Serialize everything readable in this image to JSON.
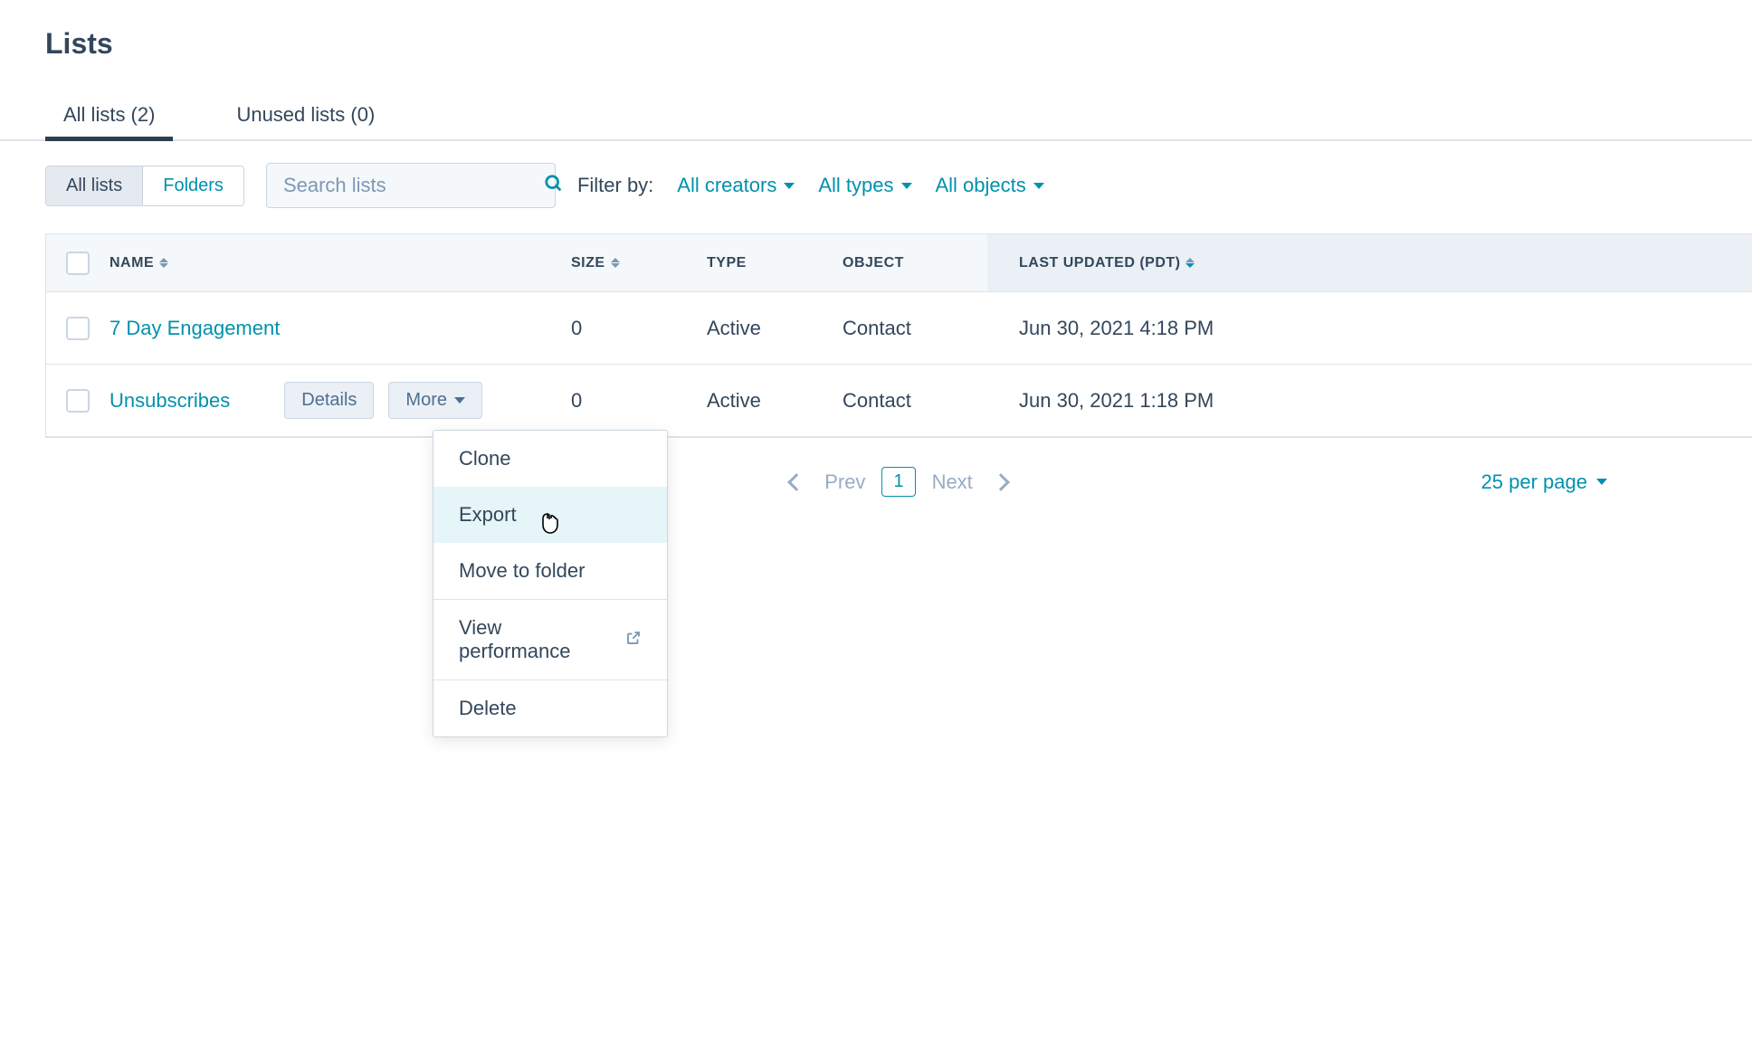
{
  "page": {
    "title": "Lists"
  },
  "tabs": [
    {
      "label": "All lists (2)",
      "active": true
    },
    {
      "label": "Unused lists (0)",
      "active": false
    }
  ],
  "segmented": {
    "all_lists": "All lists",
    "folders": "Folders"
  },
  "search": {
    "placeholder": "Search lists"
  },
  "filters": {
    "label": "Filter by:",
    "creators": "All creators",
    "types": "All types",
    "objects": "All objects"
  },
  "columns": {
    "name": "NAME",
    "size": "SIZE",
    "type": "TYPE",
    "object": "OBJECT",
    "last_updated": "LAST UPDATED (PDT)"
  },
  "rows": [
    {
      "name": "7 Day Engagement",
      "size": "0",
      "type": "Active",
      "object": "Contact",
      "updated": "Jun 30, 2021 4:18 PM"
    },
    {
      "name": "Unsubscribes",
      "size": "0",
      "type": "Active",
      "object": "Contact",
      "updated": "Jun 30, 2021 1:18 PM"
    }
  ],
  "row_actions": {
    "details": "Details",
    "more": "More"
  },
  "dropdown": {
    "clone": "Clone",
    "export": "Export",
    "move": "Move to folder",
    "view_perf": "View performance",
    "delete": "Delete"
  },
  "pagination": {
    "prev": "Prev",
    "page": "1",
    "next": "Next",
    "per_page": "25 per page"
  }
}
